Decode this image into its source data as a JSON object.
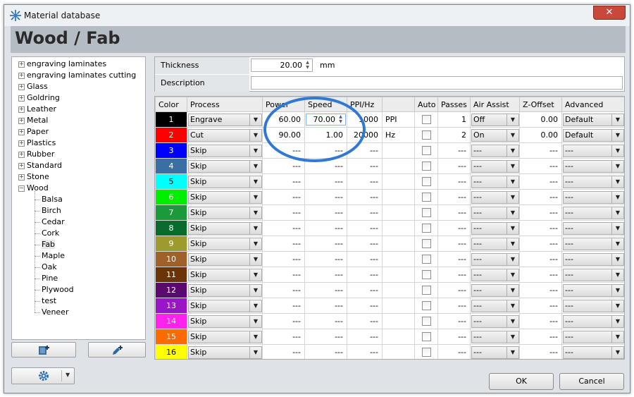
{
  "window": {
    "title": "Material database",
    "close_label": "✕"
  },
  "header": {
    "page_title": "Wood / Fab"
  },
  "tree": {
    "items": [
      {
        "label": "engraving laminates",
        "expander": "+"
      },
      {
        "label": "engraving laminates cutting",
        "expander": "+"
      },
      {
        "label": "Glass",
        "expander": "+"
      },
      {
        "label": "Goldring",
        "expander": "+"
      },
      {
        "label": "Leather",
        "expander": "+"
      },
      {
        "label": "Metal",
        "expander": "+"
      },
      {
        "label": "Paper",
        "expander": "+"
      },
      {
        "label": "Plastics",
        "expander": "+"
      },
      {
        "label": "Rubber",
        "expander": "+"
      },
      {
        "label": "Standard",
        "expander": "+"
      },
      {
        "label": "Stone",
        "expander": "+"
      },
      {
        "label": "Wood",
        "expander": "−"
      }
    ],
    "children": [
      "Balsa",
      "Birch",
      "Cedar",
      "Cork",
      "Fab",
      "Maple",
      "Oak",
      "Pine",
      "Plywood",
      "test",
      "Veneer"
    ],
    "selected": "Fab"
  },
  "toolbar": {
    "new_icon": "add-material-icon",
    "edit_icon": "add-pen-icon",
    "settings_icon": "gear-icon",
    "settings_arrow": "▼"
  },
  "properties": {
    "thickness_label": "Thickness",
    "thickness_value": "20.00",
    "thickness_unit": "mm",
    "description_label": "Description",
    "description_value": ""
  },
  "grid": {
    "columns": [
      "Color",
      "Process",
      "Power",
      "Speed",
      "PPI/Hz",
      "",
      "Auto",
      "Passes",
      "Air Assist",
      "Z-Offset",
      "Advanced"
    ],
    "rows": [
      {
        "n": "1",
        "color": "#000000",
        "text_color": "#ffffff",
        "process": "Engrave",
        "power": "60.00",
        "speed": "70.00",
        "ppi": "1000",
        "unit": "PPI",
        "passes": "1",
        "air": "Off",
        "z": "0.00",
        "adv": "Default"
      },
      {
        "n": "2",
        "color": "#ff0000",
        "text_color": "#ffffff",
        "process": "Cut",
        "power": "90.00",
        "speed": "1.00",
        "ppi": "20000",
        "unit": "Hz",
        "passes": "2",
        "air": "On",
        "z": "0.00",
        "adv": "Default"
      },
      {
        "n": "3",
        "color": "#0000ff",
        "text_color": "#ffffff",
        "process": "Skip",
        "power": "---",
        "speed": "---",
        "ppi": "---",
        "unit": "",
        "passes": "---",
        "air": "---",
        "z": "---",
        "adv": "---"
      },
      {
        "n": "4",
        "color": "#3a6ea5",
        "text_color": "#ffffff",
        "process": "Skip",
        "power": "---",
        "speed": "---",
        "ppi": "---",
        "unit": "",
        "passes": "---",
        "air": "---",
        "z": "---",
        "adv": "---"
      },
      {
        "n": "5",
        "color": "#00ffff",
        "text_color": "#000000",
        "process": "Skip",
        "power": "---",
        "speed": "---",
        "ppi": "---",
        "unit": "",
        "passes": "---",
        "air": "---",
        "z": "---",
        "adv": "---"
      },
      {
        "n": "6",
        "color": "#00ee00",
        "text_color": "#ffffff",
        "process": "Skip",
        "power": "---",
        "speed": "---",
        "ppi": "---",
        "unit": "",
        "passes": "---",
        "air": "---",
        "z": "---",
        "adv": "---"
      },
      {
        "n": "7",
        "color": "#1a9a3a",
        "text_color": "#ffffff",
        "process": "Skip",
        "power": "---",
        "speed": "---",
        "ppi": "---",
        "unit": "",
        "passes": "---",
        "air": "---",
        "z": "---",
        "adv": "---"
      },
      {
        "n": "8",
        "color": "#0b6b2e",
        "text_color": "#ffffff",
        "process": "Skip",
        "power": "---",
        "speed": "---",
        "ppi": "---",
        "unit": "",
        "passes": "---",
        "air": "---",
        "z": "---",
        "adv": "---"
      },
      {
        "n": "9",
        "color": "#9e9a2e",
        "text_color": "#ffffff",
        "process": "Skip",
        "power": "---",
        "speed": "---",
        "ppi": "---",
        "unit": "",
        "passes": "---",
        "air": "---",
        "z": "---",
        "adv": "---"
      },
      {
        "n": "10",
        "color": "#a0602a",
        "text_color": "#ffffff",
        "process": "Skip",
        "power": "---",
        "speed": "---",
        "ppi": "---",
        "unit": "",
        "passes": "---",
        "air": "---",
        "z": "---",
        "adv": "---"
      },
      {
        "n": "11",
        "color": "#6b3308",
        "text_color": "#ffffff",
        "process": "Skip",
        "power": "---",
        "speed": "---",
        "ppi": "---",
        "unit": "",
        "passes": "---",
        "air": "---",
        "z": "---",
        "adv": "---"
      },
      {
        "n": "12",
        "color": "#5a0a6e",
        "text_color": "#ffffff",
        "process": "Skip",
        "power": "---",
        "speed": "---",
        "ppi": "---",
        "unit": "",
        "passes": "---",
        "air": "---",
        "z": "---",
        "adv": "---"
      },
      {
        "n": "13",
        "color": "#9a14c8",
        "text_color": "#ffffff",
        "process": "Skip",
        "power": "---",
        "speed": "---",
        "ppi": "---",
        "unit": "",
        "passes": "---",
        "air": "---",
        "z": "---",
        "adv": "---"
      },
      {
        "n": "14",
        "color": "#ff22ee",
        "text_color": "#ffffff",
        "process": "Skip",
        "power": "---",
        "speed": "---",
        "ppi": "---",
        "unit": "",
        "passes": "---",
        "air": "---",
        "z": "---",
        "adv": "---"
      },
      {
        "n": "15",
        "color": "#ff6a00",
        "text_color": "#ffffff",
        "process": "Skip",
        "power": "---",
        "speed": "---",
        "ppi": "---",
        "unit": "",
        "passes": "---",
        "air": "---",
        "z": "---",
        "adv": "---"
      },
      {
        "n": "16",
        "color": "#ffff00",
        "text_color": "#000000",
        "process": "Skip",
        "power": "---",
        "speed": "---",
        "ppi": "---",
        "unit": "",
        "passes": "---",
        "air": "---",
        "z": "---",
        "adv": "---"
      }
    ]
  },
  "footer": {
    "ok_label": "OK",
    "cancel_label": "Cancel"
  }
}
